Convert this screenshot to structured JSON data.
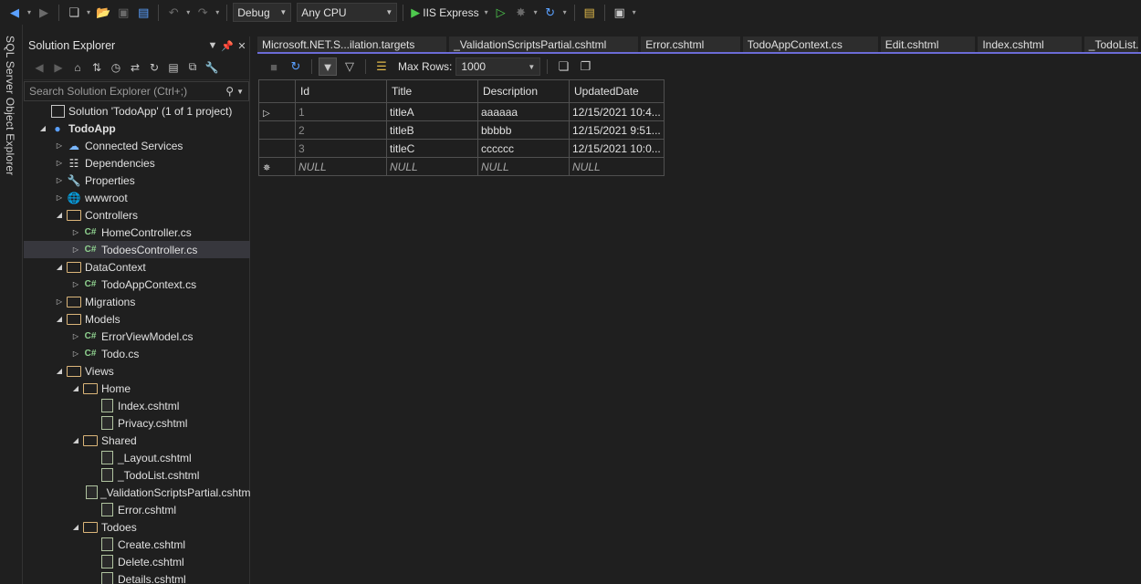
{
  "toolbar": {
    "config": "Debug",
    "platform": "Any CPU",
    "run_target": "IIS Express"
  },
  "left_rail": {
    "tab": "SQL Server Object Explorer"
  },
  "solution_explorer": {
    "title": "Solution Explorer",
    "search_placeholder": "Search Solution Explorer (Ctrl+;)",
    "tree": [
      {
        "label": "Solution 'TodoApp' (1 of 1 project)",
        "icon": "solution-icon",
        "depth": 0,
        "exp": ""
      },
      {
        "label": "TodoApp",
        "icon": "project-icon",
        "depth": 0,
        "exp": "open",
        "bold": true
      },
      {
        "label": "Connected Services",
        "icon": "connected-services-icon",
        "depth": 1,
        "exp": "closed"
      },
      {
        "label": "Dependencies",
        "icon": "dependencies-icon",
        "depth": 1,
        "exp": "closed"
      },
      {
        "label": "Properties",
        "icon": "properties-icon",
        "depth": 1,
        "exp": "closed"
      },
      {
        "label": "wwwroot",
        "icon": "globe-icon",
        "depth": 1,
        "exp": "closed"
      },
      {
        "label": "Controllers",
        "icon": "folder-icon",
        "depth": 1,
        "exp": "open"
      },
      {
        "label": "HomeController.cs",
        "icon": "csharp-file-icon",
        "depth": 2,
        "exp": "closed"
      },
      {
        "label": "TodoesController.cs",
        "icon": "csharp-file-icon",
        "depth": 2,
        "exp": "closed",
        "selected": true
      },
      {
        "label": "DataContext",
        "icon": "folder-icon",
        "depth": 1,
        "exp": "open"
      },
      {
        "label": "TodoAppContext.cs",
        "icon": "csharp-file-icon",
        "depth": 2,
        "exp": "closed"
      },
      {
        "label": "Migrations",
        "icon": "folder-icon",
        "depth": 1,
        "exp": "closed"
      },
      {
        "label": "Models",
        "icon": "folder-icon",
        "depth": 1,
        "exp": "open"
      },
      {
        "label": "ErrorViewModel.cs",
        "icon": "csharp-file-icon",
        "depth": 2,
        "exp": "closed"
      },
      {
        "label": "Todo.cs",
        "icon": "csharp-file-icon",
        "depth": 2,
        "exp": "closed"
      },
      {
        "label": "Views",
        "icon": "folder-icon",
        "depth": 1,
        "exp": "open"
      },
      {
        "label": "Home",
        "icon": "folder-icon",
        "depth": 2,
        "exp": "open"
      },
      {
        "label": "Index.cshtml",
        "icon": "cshtml-file-icon",
        "depth": 3,
        "exp": ""
      },
      {
        "label": "Privacy.cshtml",
        "icon": "cshtml-file-icon",
        "depth": 3,
        "exp": ""
      },
      {
        "label": "Shared",
        "icon": "folder-icon",
        "depth": 2,
        "exp": "open"
      },
      {
        "label": "_Layout.cshtml",
        "icon": "cshtml-file-icon",
        "depth": 3,
        "exp": ""
      },
      {
        "label": "_TodoList.cshtml",
        "icon": "cshtml-file-icon",
        "depth": 3,
        "exp": ""
      },
      {
        "label": "_ValidationScriptsPartial.cshtml",
        "icon": "cshtml-file-icon",
        "depth": 3,
        "exp": ""
      },
      {
        "label": "Error.cshtml",
        "icon": "cshtml-file-icon",
        "depth": 3,
        "exp": ""
      },
      {
        "label": "Todoes",
        "icon": "folder-icon",
        "depth": 2,
        "exp": "open"
      },
      {
        "label": "Create.cshtml",
        "icon": "cshtml-file-icon",
        "depth": 3,
        "exp": ""
      },
      {
        "label": "Delete.cshtml",
        "icon": "cshtml-file-icon",
        "depth": 3,
        "exp": ""
      },
      {
        "label": "Details.cshtml",
        "icon": "cshtml-file-icon",
        "depth": 3,
        "exp": ""
      }
    ]
  },
  "doc_tabs": [
    "Microsoft.NET.S...ilation.targets",
    "_ValidationScriptsPartial.cshtml",
    "Error.cshtml",
    "TodoAppContext.cs",
    "Edit.cshtml",
    "Index.cshtml",
    "_TodoList.cshtml"
  ],
  "data_editor": {
    "max_rows_label": "Max Rows:",
    "max_rows_value": "1000",
    "columns": [
      "Id",
      "Title",
      "Description",
      "UpdatedDate"
    ],
    "rows": [
      [
        "1",
        "titleA",
        "aaaaaa",
        "12/15/2021 10:4..."
      ],
      [
        "2",
        "titleB",
        "bbbbb",
        "12/15/2021 9:51..."
      ],
      [
        "3",
        "titleC",
        "cccccc",
        "12/15/2021 10:0..."
      ]
    ],
    "new_row": [
      "NULL",
      "NULL",
      "NULL",
      "NULL"
    ]
  },
  "colors": {
    "accent": "#6b6bd6",
    "background": "#1f1f1f",
    "tab_bg": "#2d2d2d",
    "folder": "#dcb67a"
  }
}
